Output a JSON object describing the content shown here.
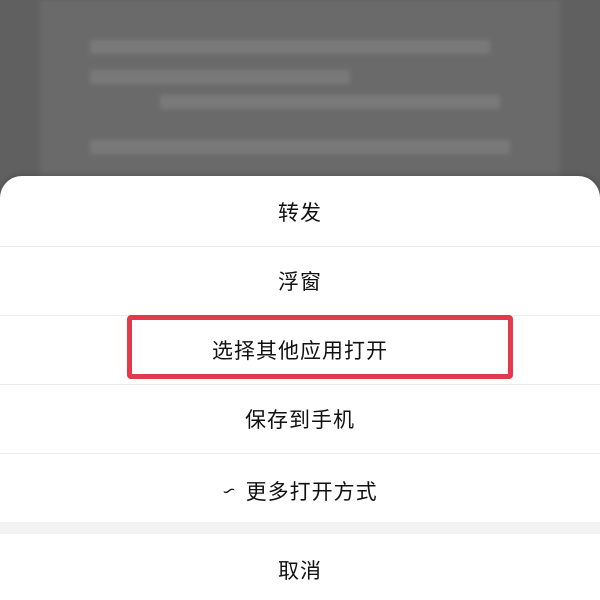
{
  "sheet": {
    "items": [
      {
        "label": "转发"
      },
      {
        "label": "浮窗"
      },
      {
        "label": "选择其他应用打开"
      },
      {
        "label": "保存到手机"
      },
      {
        "label": "更多打开方式"
      }
    ],
    "cancel_label": "取消"
  },
  "colors": {
    "highlight": "#e23a4b",
    "sheet_background": "#ffffff",
    "overlay": "#6d6d6d"
  },
  "icons": {
    "more_open_ways": "link-icon"
  }
}
